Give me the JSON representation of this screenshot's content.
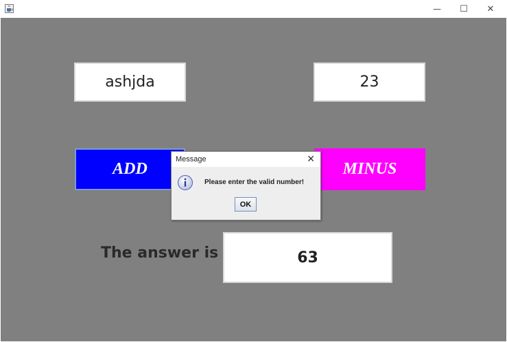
{
  "window": {
    "controls": {
      "minimize_glyph": "—",
      "maximize_glyph": "☐",
      "close_glyph": "✕"
    },
    "app_icon": "java-cup-icon"
  },
  "inputs": {
    "first_value": "ashjda",
    "second_value": "23"
  },
  "buttons": {
    "add_label": "ADD",
    "minus_label": "MINUS",
    "add_color": "#0000ff",
    "minus_color": "#ff00ff"
  },
  "result": {
    "label": "The answer is",
    "value": "63"
  },
  "dialog": {
    "title": "Message",
    "close_glyph": "✕",
    "icon": "info-icon",
    "message": "Please enter the valid number!",
    "ok_label": "OK"
  },
  "colors": {
    "background": "#808080"
  }
}
